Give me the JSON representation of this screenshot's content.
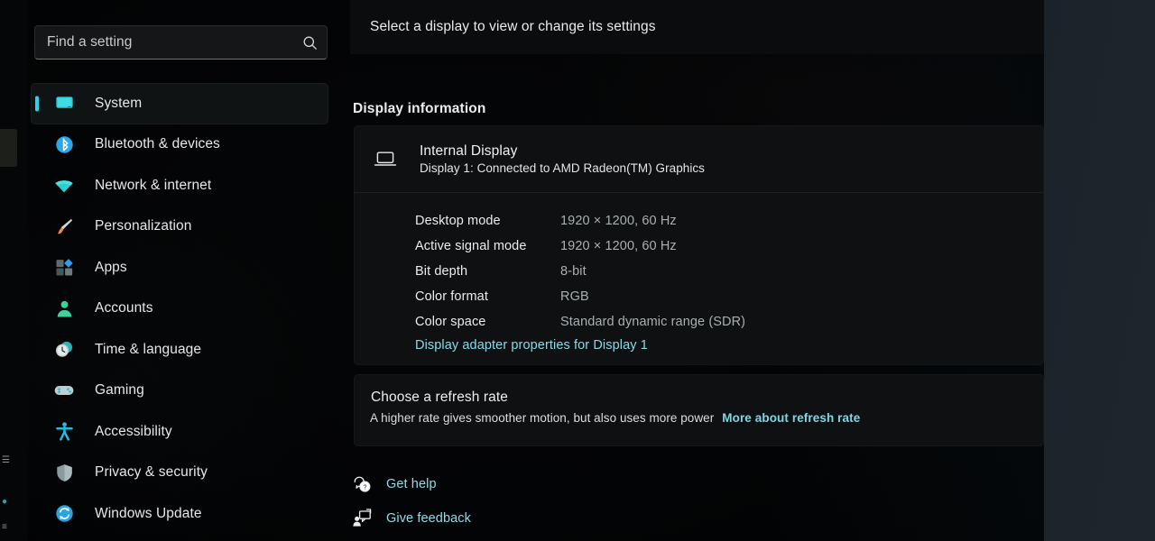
{
  "search": {
    "placeholder": "Find a setting",
    "value": "",
    "icon": "search-icon"
  },
  "sidebar": {
    "items": [
      {
        "label": "System",
        "icon": "monitor-icon",
        "selected": true
      },
      {
        "label": "Bluetooth & devices",
        "icon": "bluetooth-icon",
        "selected": false
      },
      {
        "label": "Network & internet",
        "icon": "wifi-icon",
        "selected": false
      },
      {
        "label": "Personalization",
        "icon": "paintbrush-icon",
        "selected": false
      },
      {
        "label": "Apps",
        "icon": "apps-squares-icon",
        "selected": false
      },
      {
        "label": "Accounts",
        "icon": "person-icon",
        "selected": false
      },
      {
        "label": "Time & language",
        "icon": "clock-icon",
        "selected": false
      },
      {
        "label": "Gaming",
        "icon": "gamepad-icon",
        "selected": false
      },
      {
        "label": "Accessibility",
        "icon": "accessibility-icon",
        "selected": false
      },
      {
        "label": "Privacy & security",
        "icon": "shield-icon",
        "selected": false
      },
      {
        "label": "Windows Update",
        "icon": "update-refresh-icon",
        "selected": false
      }
    ]
  },
  "main": {
    "select_display_text": "Select a display to view or change its settings",
    "display_information_title": "Display information",
    "display": {
      "icon": "laptop-display-icon",
      "name": "Internal Display",
      "subtitle": "Display 1: Connected to AMD Radeon(TM) Graphics",
      "properties": [
        {
          "key": "Desktop mode",
          "value": "1920 × 1200, 60 Hz"
        },
        {
          "key": "Active signal mode",
          "value": "1920 × 1200, 60 Hz"
        },
        {
          "key": "Bit depth",
          "value": "8-bit"
        },
        {
          "key": "Color format",
          "value": "RGB"
        },
        {
          "key": "Color space",
          "value": "Standard dynamic range (SDR)"
        }
      ],
      "adapter_link": "Display adapter properties for Display 1"
    },
    "refresh_rate": {
      "title": "Choose a refresh rate",
      "description": "A higher rate gives smoother motion, but also uses more power",
      "more_link": "More about refresh rate"
    },
    "footer": [
      {
        "label": "Get help",
        "icon": "help-question-bubble-icon"
      },
      {
        "label": "Give feedback",
        "icon": "feedback-person-bubble-icon"
      }
    ]
  },
  "colors": {
    "accent_cyan": "#27d4e8",
    "link": "#86dbe6",
    "bluetooth_blue": "#2aa8ec",
    "wifi_teal": "#25d2cd",
    "accounts_green": "#3fd19a",
    "screen_black": "#050607",
    "bezel": "#1d252c"
  }
}
